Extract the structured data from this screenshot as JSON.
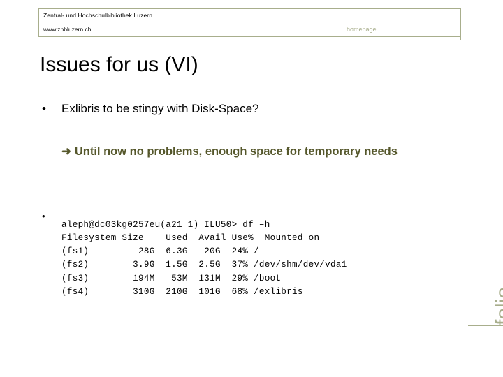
{
  "header": {
    "organization": "Zentral- und Hochschulbibliothek Luzern",
    "url": "www.zhbluzern.ch",
    "homepage_label": "homepage"
  },
  "slide": {
    "title": "Issues for us (VI)",
    "bullet_marker": "•",
    "bullet_level1": "Exlibris to be stingy with Disk-Space?",
    "arrow_glyph": "➜",
    "arrow_text": "Until now no problems, enough space for temporary needs",
    "terminal_marker": "•",
    "terminal_output": "aleph@dc03kg0257eu(a21_1) ILU50> df –h\nFilesystem Size    Used  Avail Use%  Mounted on\n(fs1)         28G  6.3G   20G  24% /\n(fs2)        3.9G  1.5G  2.5G  37% /dev/shm/dev/vda1\n(fs3)        194M   53M  131M  29% /boot\n(fs4)        310G  210G  101G  68% /exlibris",
    "footer_label": "folie"
  },
  "colors": {
    "olive_light": "#a8ae8c",
    "olive_dark": "#55572b",
    "text": "#000000",
    "background": "#ffffff"
  }
}
